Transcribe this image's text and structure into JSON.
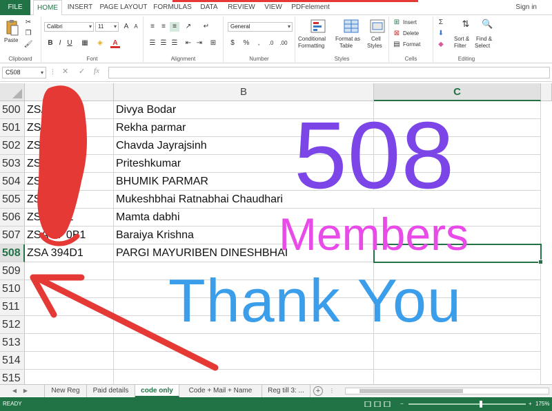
{
  "tabs": {
    "file": "FILE",
    "items": [
      {
        "label": "HOME",
        "active": true
      },
      {
        "label": "INSERT",
        "active": false
      },
      {
        "label": "PAGE LAYOUT",
        "active": false
      },
      {
        "label": "FORMULAS",
        "active": false
      },
      {
        "label": "DATA",
        "active": false
      },
      {
        "label": "REVIEW",
        "active": false
      },
      {
        "label": "VIEW",
        "active": false
      },
      {
        "label": "PDFelement",
        "active": false
      }
    ],
    "signin": "Sign in"
  },
  "ribbon": {
    "clipboard": {
      "label": "Clipboard",
      "paste": "Paste"
    },
    "font": {
      "label": "Font",
      "family": "Calibri",
      "size": "11",
      "bold": "B",
      "italic": "I",
      "underline": "U"
    },
    "alignment": {
      "label": "Alignment"
    },
    "number": {
      "label": "Number",
      "format": "General",
      "currency": "$",
      "percent": "%",
      "comma": ","
    },
    "styles": {
      "label": "Styles",
      "conditional": "Conditional",
      "conditional2": "Formatting",
      "format_as": "Format as",
      "format_as2": "Table",
      "cell": "Cell",
      "cell2": "Styles"
    },
    "cells": {
      "label": "Cells",
      "insert": "Insert",
      "delete": "Delete",
      "format": "Format"
    },
    "editing": {
      "label": "Editing",
      "sort": "Sort &",
      "sort2": "Filter",
      "find": "Find &",
      "find2": "Select"
    }
  },
  "formula_bar": {
    "name_box": "C508",
    "fx": "fx",
    "value": ""
  },
  "columns": {
    "b": "B",
    "c": "C"
  },
  "rows": [
    {
      "num": "500",
      "a": "ZSA5    B    1",
      "b": "Divya Bodar"
    },
    {
      "num": "501",
      "a": "ZSA        M1",
      "b": "Rekha parmar"
    },
    {
      "num": "502",
      "a": "ZSA          1",
      "b": "Chavda Jayrajsinh"
    },
    {
      "num": "503",
      "a": "ZSA          A1",
      "b": "Priteshkumar"
    },
    {
      "num": "504",
      "a": "ZSA5         51",
      "b": "BHUMIK PARMAR"
    },
    {
      "num": "505",
      "a": "ZSA          P1",
      "b": "Mukeshbhai Ratnabhai Chaudhari"
    },
    {
      "num": "506",
      "a": "ZSA       4    B1",
      "b": "Mamta dabhi"
    },
    {
      "num": "507",
      "a": "ZSA    87    0B1",
      "b": "Baraiya Krishna"
    },
    {
      "num": "508",
      "a": "ZSA      394D1",
      "b": "PARGI MAYURIBEN DINESHBHAI"
    },
    {
      "num": "509",
      "a": "",
      "b": ""
    },
    {
      "num": "510",
      "a": "",
      "b": ""
    },
    {
      "num": "511",
      "a": "",
      "b": ""
    },
    {
      "num": "512",
      "a": "",
      "b": ""
    },
    {
      "num": "513",
      "a": "",
      "b": ""
    },
    {
      "num": "514",
      "a": "",
      "b": ""
    },
    {
      "num": "515",
      "a": "",
      "b": ""
    }
  ],
  "overlay": {
    "number": "508",
    "members": "Members",
    "thanks": "Thank You"
  },
  "sheets": [
    {
      "label": "New Reg",
      "active": false
    },
    {
      "label": "Paid details",
      "active": false
    },
    {
      "label": "code only",
      "active": true
    },
    {
      "label": "Code + Mail + Name",
      "active": false
    },
    {
      "label": "Reg till 3:  ...",
      "active": false
    }
  ],
  "status": {
    "ready": "READY",
    "zoom": "175%",
    "zoom_fraction": 0.62
  },
  "colors": {
    "accent": "#217346",
    "number": "#7c45e8",
    "members": "#e84be8",
    "thanks": "#3a9eea",
    "scribble": "#e53935"
  }
}
